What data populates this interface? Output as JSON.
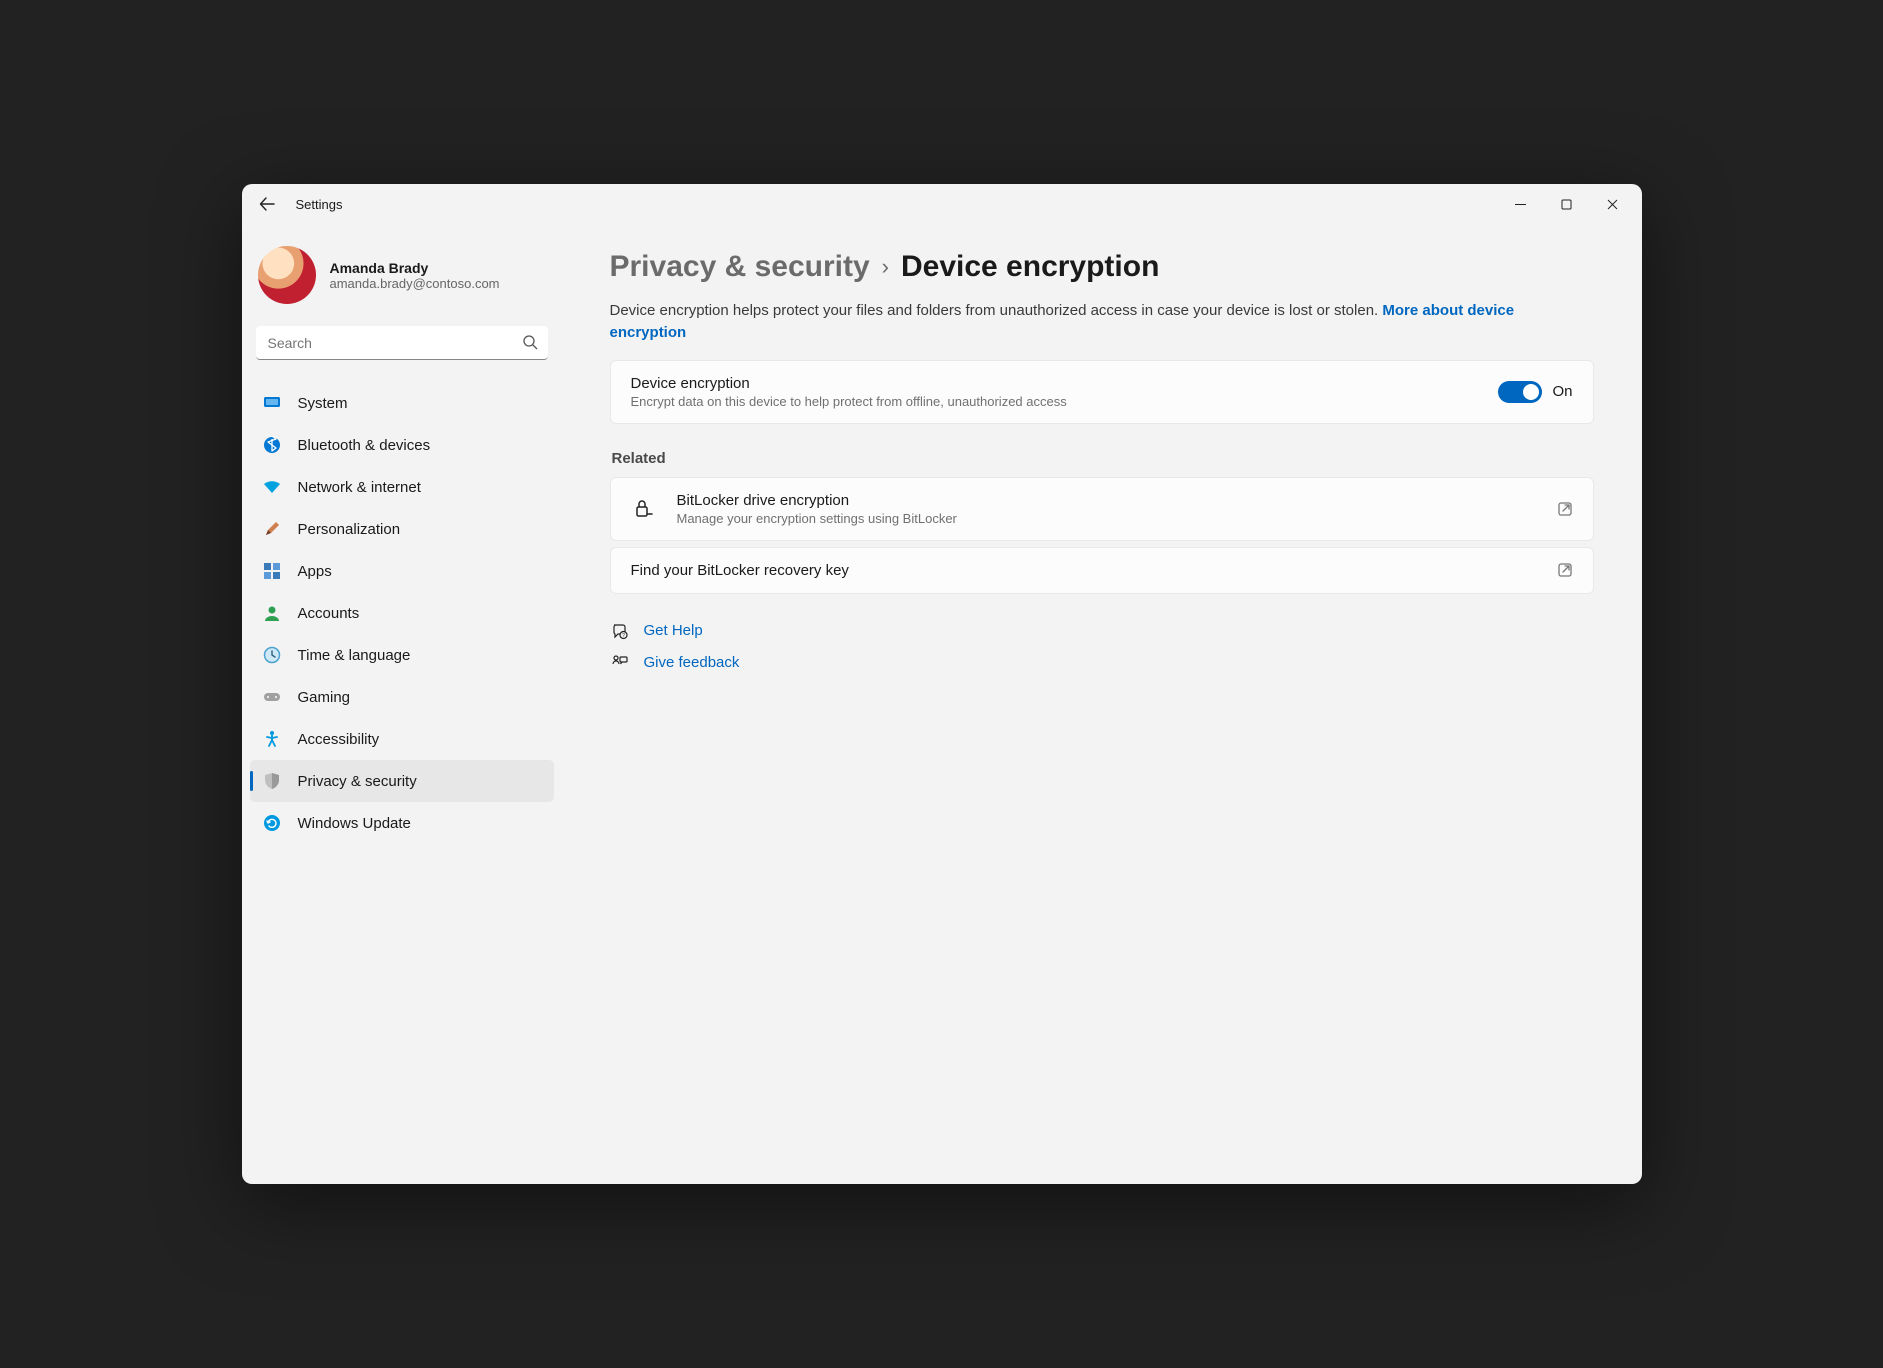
{
  "window": {
    "title": "Settings"
  },
  "profile": {
    "name": "Amanda Brady",
    "email": "amanda.brady@contoso.com"
  },
  "search": {
    "placeholder": "Search"
  },
  "nav": {
    "items": [
      {
        "label": "System",
        "icon": "display-icon",
        "color": "#0078d4"
      },
      {
        "label": "Bluetooth & devices",
        "icon": "bluetooth-icon",
        "color": "#0078d4"
      },
      {
        "label": "Network & internet",
        "icon": "wifi-icon",
        "color": "#00a3e0"
      },
      {
        "label": "Personalization",
        "icon": "brush-icon",
        "color": "#c06030"
      },
      {
        "label": "Apps",
        "icon": "apps-icon",
        "color": "#3a7ab8"
      },
      {
        "label": "Accounts",
        "icon": "person-icon",
        "color": "#2fa052"
      },
      {
        "label": "Time & language",
        "icon": "clock-icon",
        "color": "#4aa0d0"
      },
      {
        "label": "Gaming",
        "icon": "gamepad-icon",
        "color": "#8a8a8a"
      },
      {
        "label": "Accessibility",
        "icon": "accessibility-icon",
        "color": "#0099e0"
      },
      {
        "label": "Privacy & security",
        "icon": "shield-icon",
        "color": "#8a8a8a"
      },
      {
        "label": "Windows Update",
        "icon": "update-icon",
        "color": "#0099e0"
      }
    ],
    "activeIndex": 9
  },
  "breadcrumb": {
    "parent": "Privacy & security",
    "current": "Device encryption"
  },
  "description": {
    "text": "Device encryption helps protect your files and folders from unauthorized access in case your device is lost or stolen. ",
    "link": "More about device encryption"
  },
  "encryption": {
    "title": "Device encryption",
    "sub": "Encrypt data on this device to help protect from offline, unauthorized access",
    "state": "On"
  },
  "related": {
    "label": "Related",
    "bitlocker": {
      "title": "BitLocker drive encryption",
      "sub": "Manage your encryption settings using BitLocker"
    },
    "recovery": {
      "title": "Find your BitLocker recovery key"
    }
  },
  "footer": {
    "help": "Get Help",
    "feedback": "Give feedback"
  }
}
